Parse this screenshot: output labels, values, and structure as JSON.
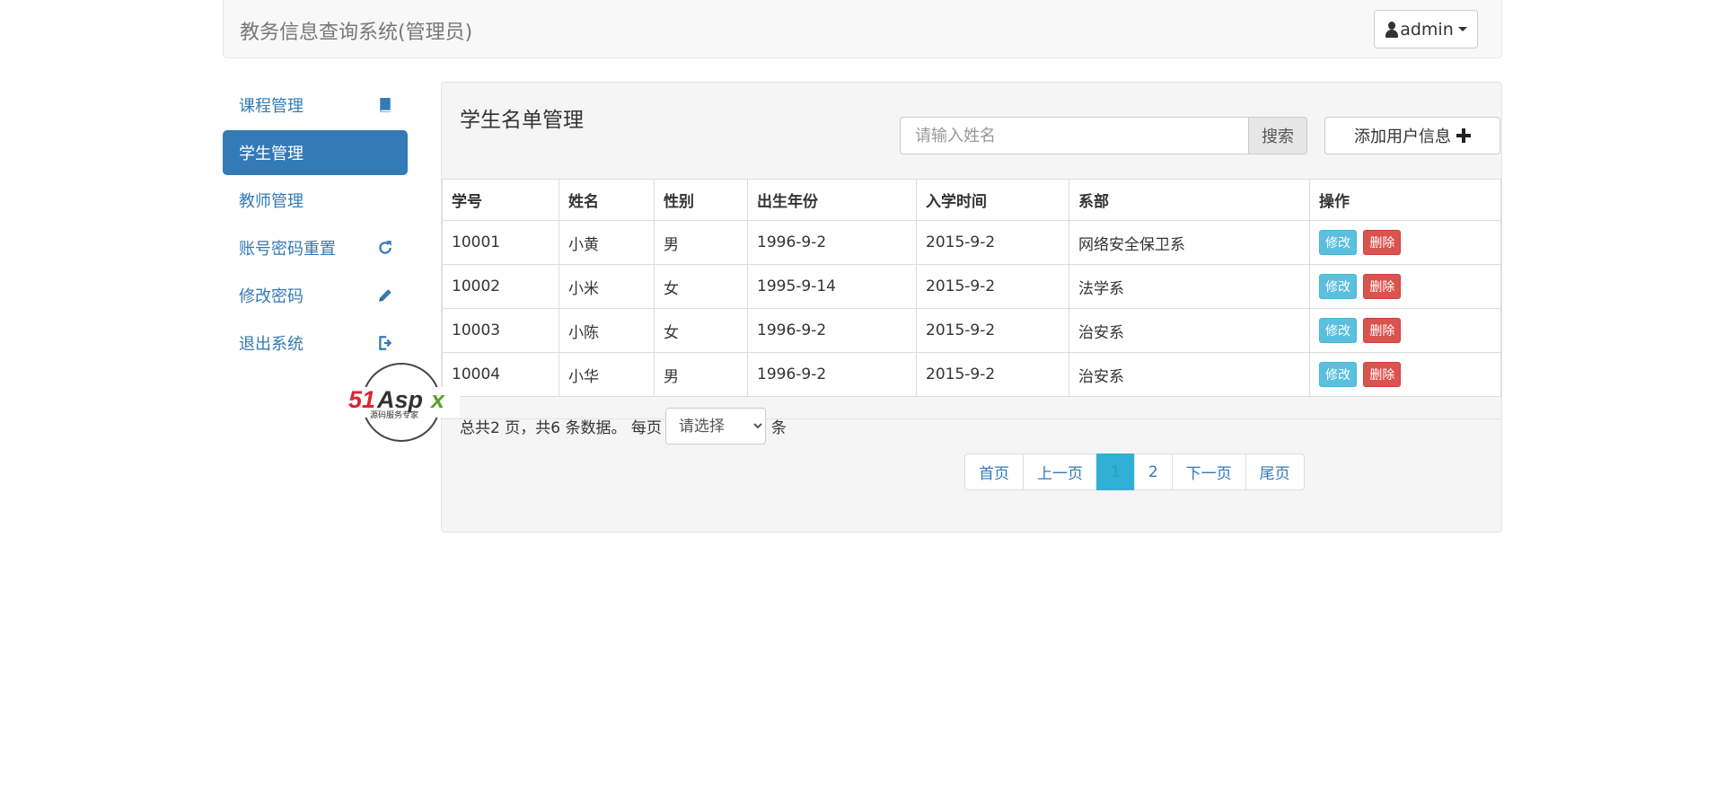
{
  "header": {
    "title": "教务信息查询系统(管理员)",
    "user": "admin"
  },
  "sidebar": {
    "items": [
      {
        "label": "课程管理",
        "icon": "book-icon",
        "active": false
      },
      {
        "label": "学生管理",
        "icon": "",
        "active": true
      },
      {
        "label": "教师管理",
        "icon": "",
        "active": false
      },
      {
        "label": "账号密码重置",
        "icon": "refresh-icon",
        "active": false
      },
      {
        "label": "修改密码",
        "icon": "pencil-icon",
        "active": false
      },
      {
        "label": "退出系统",
        "icon": "logout-icon",
        "active": false
      }
    ]
  },
  "main": {
    "title": "学生名单管理",
    "search": {
      "placeholder": "请输入姓名",
      "button": "搜索"
    },
    "add_button": "添加用户信息",
    "table": {
      "headers": [
        "学号",
        "姓名",
        "性别",
        "出生年份",
        "入学时间",
        "系部",
        "操作"
      ],
      "rows": [
        [
          "10001",
          "小黄",
          "男",
          "1996-9-2",
          "2015-9-2",
          "网络安全保卫系"
        ],
        [
          "10002",
          "小米",
          "女",
          "1995-9-14",
          "2015-9-2",
          "法学系"
        ],
        [
          "10003",
          "小陈",
          "女",
          "1996-9-2",
          "2015-9-2",
          "治安系"
        ],
        [
          "10004",
          "小华",
          "男",
          "1996-9-2",
          "2015-9-2",
          "治安系"
        ]
      ],
      "edit_label": "修改",
      "delete_label": "删除"
    },
    "summary": {
      "prefix": "总共2 页，共6 条数据。 每页",
      "select": "请选择",
      "suffix": "条"
    },
    "pagination": [
      "首页",
      "上一页",
      "1",
      "2",
      "下一页",
      "尾页"
    ],
    "current_page": "1"
  },
  "watermark": {
    "brand": "51Aspx",
    "tagline": "源码服务专家"
  },
  "colors": {
    "primary": "#337ab7",
    "info": "#5bc0de",
    "danger": "#d9534f"
  }
}
